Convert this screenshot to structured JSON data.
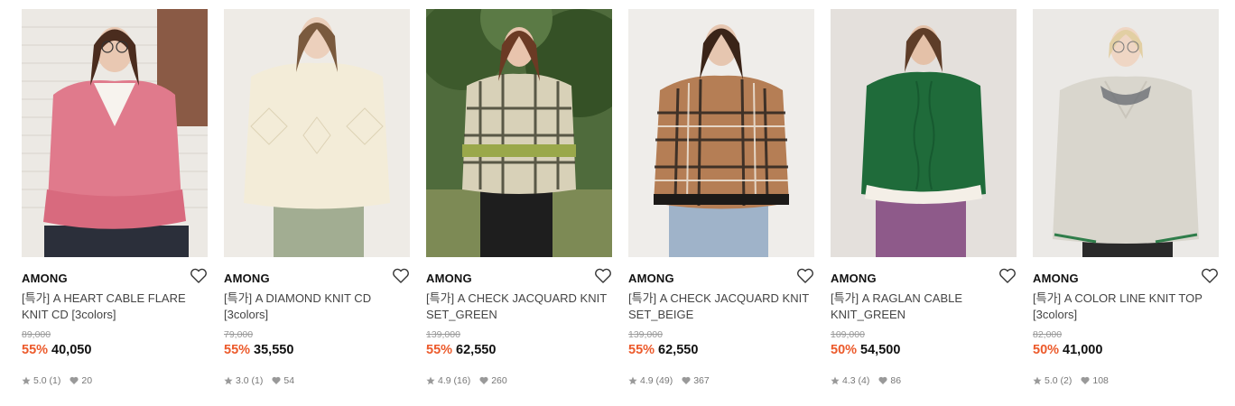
{
  "colors": {
    "discount": "#ec5a2b",
    "brand": "#111111",
    "muted": "#999999"
  },
  "products": [
    {
      "brand": "AMONG",
      "title": "[특가] A HEART CABLE FLARE KNIT CD [3colors]",
      "original_price": "89,000",
      "discount": "55%",
      "price": "40,050",
      "rating": "5.0",
      "reviews": "(1)",
      "likes": "20",
      "wish_icon": "heart-outline-icon"
    },
    {
      "brand": "AMONG",
      "title": "[특가] A DIAMOND KNIT CD [3colors]",
      "original_price": "79,000",
      "discount": "55%",
      "price": "35,550",
      "rating": "3.0",
      "reviews": "(1)",
      "likes": "54",
      "wish_icon": "heart-outline-icon"
    },
    {
      "brand": "AMONG",
      "title": "[특가] A CHECK JACQUARD KNIT SET_GREEN",
      "original_price": "139,000",
      "discount": "55%",
      "price": "62,550",
      "rating": "4.9",
      "reviews": "(16)",
      "likes": "260",
      "wish_icon": "heart-outline-icon"
    },
    {
      "brand": "AMONG",
      "title": "[특가] A CHECK JACQUARD KNIT SET_BEIGE",
      "original_price": "139,000",
      "discount": "55%",
      "price": "62,550",
      "rating": "4.9",
      "reviews": "(49)",
      "likes": "367",
      "wish_icon": "heart-outline-icon"
    },
    {
      "brand": "AMONG",
      "title": "[특가] A RAGLAN CABLE KNIT_GREEN",
      "original_price": "109,000",
      "discount": "50%",
      "price": "54,500",
      "rating": "4.3",
      "reviews": "(4)",
      "likes": "86",
      "wish_icon": "heart-outline-icon"
    },
    {
      "brand": "AMONG",
      "title": "[특가] A COLOR LINE KNIT TOP [3colors]",
      "original_price": "82,000",
      "discount": "50%",
      "price": "41,000",
      "rating": "5.0",
      "reviews": "(2)",
      "likes": "108",
      "wish_icon": "heart-outline-icon"
    }
  ]
}
